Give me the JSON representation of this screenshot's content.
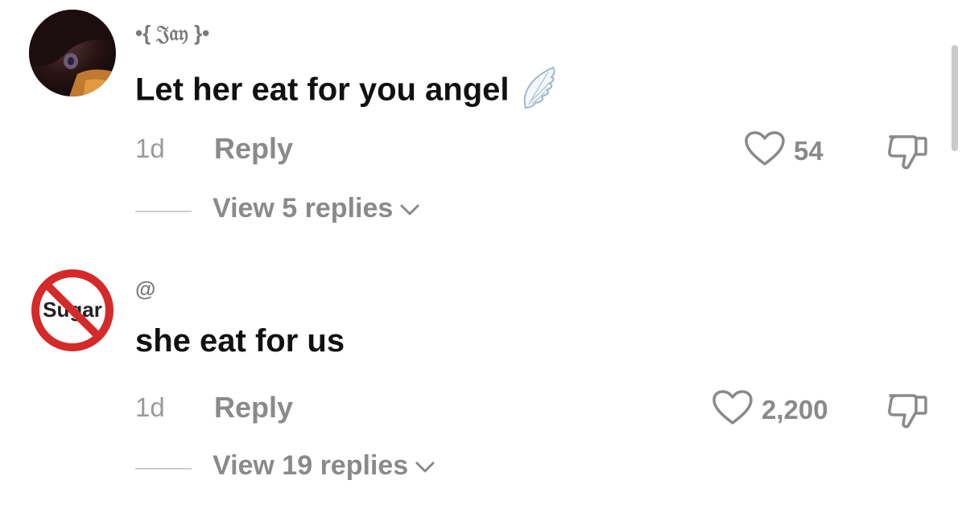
{
  "comments": [
    {
      "username": "•{ 𝔍𝔞𝔶 }•",
      "text": "Let her eat for you angel",
      "time": "1d",
      "reply_label": "Reply",
      "likes": "54",
      "view_replies": "View 5 replies"
    },
    {
      "username": "@",
      "avatar_text": "Sugar",
      "text": "she eat for us",
      "time": "1d",
      "reply_label": "Reply",
      "likes": "2,200",
      "view_replies": "View 19 replies"
    }
  ],
  "icons": {
    "like": "heart-outline-icon",
    "dislike": "thumbs-down-icon",
    "expand": "chevron-down-icon",
    "emoji": "wing-emoji"
  },
  "colors": {
    "primary_text": "#111111",
    "secondary_text": "#8a8a8a",
    "no_sign_red": "#d42a2a"
  }
}
